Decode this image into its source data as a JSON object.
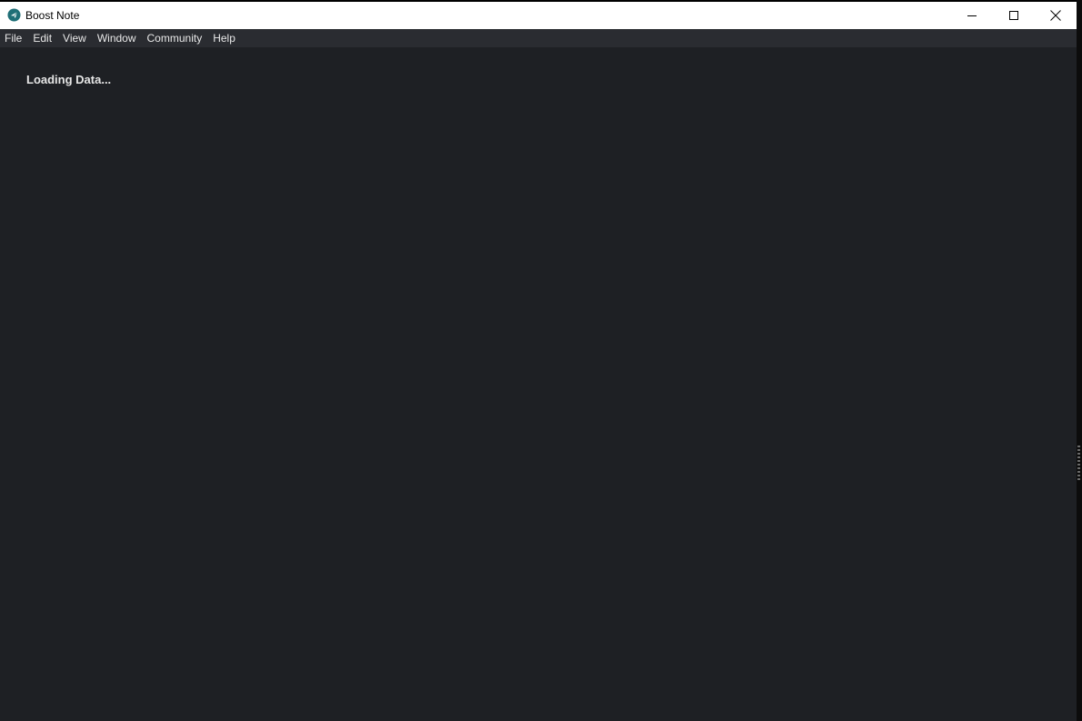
{
  "window": {
    "title": "Boost Note",
    "app_icon": "boost-note-logo-icon",
    "controls": {
      "minimize_icon": "minimize-icon",
      "maximize_icon": "maximize-icon",
      "close_icon": "close-icon"
    }
  },
  "menu": {
    "items": [
      {
        "label": "File"
      },
      {
        "label": "Edit"
      },
      {
        "label": "View"
      },
      {
        "label": "Window"
      },
      {
        "label": "Community"
      },
      {
        "label": "Help"
      }
    ]
  },
  "main": {
    "status": "Loading Data..."
  },
  "colors": {
    "titlebar_bg": "#ffffff",
    "menubar_bg": "#2a2c31",
    "content_bg": "#1e2024",
    "accent": "#1f6f77",
    "text_light": "#e6e6e6"
  }
}
